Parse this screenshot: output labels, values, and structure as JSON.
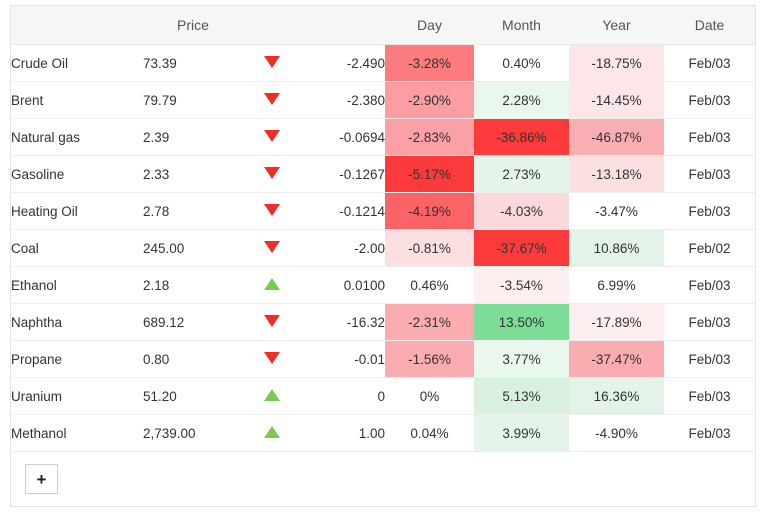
{
  "table": {
    "headers": {
      "name": "",
      "price": "Price",
      "arrow": "",
      "change": "",
      "day": "Day",
      "month": "Month",
      "year": "Year",
      "date": "Date"
    },
    "colors": {
      "strong_red": "#fb3b3b",
      "mid_red": "#fb7b7f",
      "light_red": "#fbacb0",
      "pale_red": "#fcdfe0",
      "faint_red": "#fdeeef",
      "strong_green": "#7edd98",
      "pale_green": "#d9f0df",
      "faint_green": "#e9f7ec",
      "neutral": "#ffffff",
      "up_triangle": "#7dc84e",
      "down_triangle": "#ee2e24",
      "header_bg": "#f6f6f6",
      "border": "#ededed"
    },
    "rows": [
      {
        "name": "Crude Oil",
        "price": "73.39",
        "direction": "down",
        "change": "-2.490",
        "day": "-3.28%",
        "day_bg": "#fb7b7f",
        "month": "0.40%",
        "month_bg": "#ffffff",
        "year": "-18.75%",
        "year_bg": "#fce6e7",
        "date": "Feb/03"
      },
      {
        "name": "Brent",
        "price": "79.79",
        "direction": "down",
        "change": "-2.380",
        "day": "-2.90%",
        "day_bg": "#fb9da1",
        "month": "2.28%",
        "month_bg": "#e9f7ec",
        "year": "-14.45%",
        "year_bg": "#fce6e7",
        "date": "Feb/03"
      },
      {
        "name": "Natural gas",
        "price": "2.39",
        "direction": "down",
        "change": "-0.0694",
        "day": "-2.83%",
        "day_bg": "#fba0a4",
        "month": "-36.86%",
        "month_bg": "#fb3b3b",
        "year": "-46.87%",
        "year_bg": "#f9aeb2",
        "date": "Feb/03"
      },
      {
        "name": "Gasoline",
        "price": "2.33",
        "direction": "down",
        "change": "-0.1267",
        "day": "-5.17%",
        "day_bg": "#fb3b3b",
        "month": "2.73%",
        "month_bg": "#e4f4e9",
        "year": "-13.18%",
        "year_bg": "#fce0e1",
        "date": "Feb/03"
      },
      {
        "name": "Heating Oil",
        "price": "2.78",
        "direction": "down",
        "change": "-0.1214",
        "day": "-4.19%",
        "day_bg": "#fb6367",
        "month": "-4.03%",
        "month_bg": "#fbd9da",
        "year": "-3.47%",
        "year_bg": "#ffffff",
        "date": "Feb/03"
      },
      {
        "name": "Coal",
        "price": "245.00",
        "direction": "down",
        "change": "-2.00",
        "day": "-0.81%",
        "day_bg": "#fcdfe0",
        "month": "-37.67%",
        "month_bg": "#fb3b3b",
        "year": "10.86%",
        "year_bg": "#e2f3e7",
        "date": "Feb/02"
      },
      {
        "name": "Ethanol",
        "price": "2.18",
        "direction": "up",
        "change": "0.0100",
        "day": "0.46%",
        "day_bg": "#ffffff",
        "month": "-3.54%",
        "month_bg": "#fdeeef",
        "year": "6.99%",
        "year_bg": "#ffffff",
        "date": "Feb/03"
      },
      {
        "name": "Naphtha",
        "price": "689.12",
        "direction": "down",
        "change": "-16.32",
        "day": "-2.31%",
        "day_bg": "#fbacb0",
        "month": "13.50%",
        "month_bg": "#7edd98",
        "year": "-17.89%",
        "year_bg": "#fdeeef",
        "date": "Feb/03"
      },
      {
        "name": "Propane",
        "price": "0.80",
        "direction": "down",
        "change": "-0.01",
        "day": "-1.56%",
        "day_bg": "#fbacb0",
        "month": "3.77%",
        "month_bg": "#e9f7ec",
        "year": "-37.47%",
        "year_bg": "#fbacb0",
        "date": "Feb/03"
      },
      {
        "name": "Uranium",
        "price": "51.20",
        "direction": "up",
        "change": "0",
        "day": "0%",
        "day_bg": "#ffffff",
        "month": "5.13%",
        "month_bg": "#d9f0df",
        "year": "16.36%",
        "year_bg": "#e2f3e7",
        "date": "Feb/03"
      },
      {
        "name": "Methanol",
        "price": "2,739.00",
        "direction": "up",
        "change": "1.00",
        "day": "0.04%",
        "day_bg": "#ffffff",
        "month": "3.99%",
        "month_bg": "#e4f4e9",
        "year": "-4.90%",
        "year_bg": "#ffffff",
        "date": "Feb/03"
      }
    ]
  },
  "footer": {
    "add_label": "+"
  }
}
